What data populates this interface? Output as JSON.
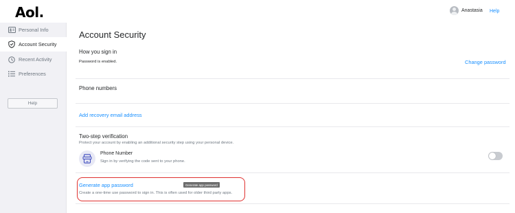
{
  "header": {
    "logo": "Aol.",
    "user_name": "Anastasia",
    "help_label": "Help"
  },
  "sidebar": {
    "items": [
      {
        "label": "Personal Info",
        "icon": "id-card-icon"
      },
      {
        "label": "Account Security",
        "icon": "shield-icon",
        "active": true
      },
      {
        "label": "Recent Activity",
        "icon": "clock-icon"
      },
      {
        "label": "Preferences",
        "icon": "list-icon"
      }
    ],
    "help_button": "Help"
  },
  "main": {
    "title": "Account Security",
    "sign_in": {
      "heading": "How you sign in",
      "status": "Password is enabled.",
      "change_link": "Change password"
    },
    "phone_numbers": {
      "heading": "Phone numbers"
    },
    "recovery_email": {
      "link": "Add recovery email address"
    },
    "two_step": {
      "heading": "Two-step verification",
      "description": "Protect your account by enabling an additional security step using your personal device.",
      "method_title": "Phone Number",
      "method_desc": "Sign in by verifying the code sent to your phone.",
      "enabled": false
    },
    "app_password": {
      "link": "Generate app password",
      "description": "Create a one-time use password to sign in. This is often used for older third party apps.",
      "tooltip": "Generate app password"
    }
  },
  "colors": {
    "link": "#188fff",
    "highlight": "#e0312f",
    "sidebar_bg": "#f1f1f5"
  }
}
